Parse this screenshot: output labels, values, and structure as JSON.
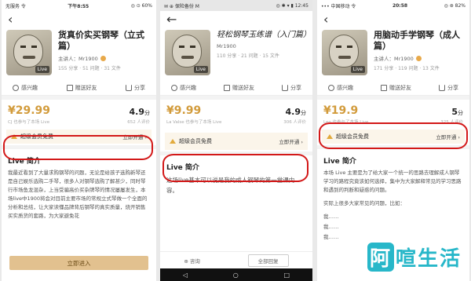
{
  "phones": [
    {
      "status": {
        "left": "无服务 令",
        "mid": "下午8:55",
        "right": "◎ ⊙ 60%"
      },
      "title": "货真价实买钢琴（立式篇）",
      "speaker": "主讲人：Mr1900",
      "stats": "155 分享 · 51 问题 · 31 文件",
      "cover_badge": "Live",
      "actions": [
        "感兴趣",
        "赠送好友",
        "分享"
      ],
      "price": "¥29.99",
      "rating": "4.9",
      "rating_unit": "分",
      "price_sub": "CJ 也参与了本场 Live",
      "rating_sub": "652 人评价",
      "vip_label": "超级会员免费",
      "vip_action": "立即开通 ›",
      "section_title": "Live 简介",
      "desc": [
        "我最近看到了大量求购钢琴的问题，无论是给孩子选购新琴还是自己娱乐选购二手琴，很多人对钢琴选购了解甚少，同时琴行市场鱼龙混杂，上当受骗高价买杂牌琴的情况屡屡发生，本场live中1900将会对目前主要市场的常规立式琴做一个全面的分析和总结，让大家读懂品牌背后钢琴的真实质量，烧开销售买实质货的套路，为大家避免花"
      ],
      "cta": "立即进入"
    },
    {
      "status": {
        "left": "✉ ⊕ 保险备份 M",
        "mid": "",
        "right": "◎ ✱ ▾ ▮ 12:45"
      },
      "title": "轻松钢琴玉练谱（入门篇）",
      "speaker": "Mr1900",
      "stats": "110 分享 · 21 问题 · 15 文件",
      "cover_badge": "Live",
      "actions": [
        "感兴趣",
        "赠送好友",
        "分享"
      ],
      "price": "¥9.99",
      "rating": "4.9",
      "rating_unit": "分",
      "price_sub": "La Valse 也参与了本场 Live",
      "rating_sub": "306 人评价",
      "vip_label": "超级会员免费",
      "vip_action": "立即开通 ›",
      "section_title": "Live 简介",
      "desc": [
        "这场live基本可以说是我的成人钢琴的第一堂课内容。"
      ],
      "bottom_left": "⊕ 咨询",
      "bottom_right": "全部回复",
      "navbar": [
        "◁",
        "○",
        "□"
      ]
    },
    {
      "status": {
        "left": "••• 中国移动 令",
        "mid": "20:58",
        "right": "◎ ⊛ 82%"
      },
      "title": "用脑动手学钢琴（成人篇）",
      "speaker": "主讲人：Mr1900",
      "stats": "171 分享 · 119 问题 · 13 文件",
      "cover_badge": "Live",
      "actions": [
        "感兴趣",
        "赠送好友",
        "分享"
      ],
      "price": "¥19.9",
      "rating": "5",
      "rating_unit": "分",
      "price_sub": "Leo 也参与了本场 Live",
      "rating_sub": "325 人评价",
      "vip_label": "超级会员免费",
      "vip_action": "立即开通 ›",
      "section_title": "Live 简介",
      "desc": [
        "本场 Live 主要是为了给大家一个统一的思路去理解成人钢琴学习的路程究竟该如何选择，集中为大家解释常见的学习思路和遇到的判断和疑惑的问题。",
        "实际上很多大家常见的问题，比如：",
        "我……",
        "我……",
        "我……"
      ],
      "cta": ""
    }
  ],
  "watermark": {
    "left": "阿",
    "right": "喧生活"
  },
  "colors": {
    "price": "#d29b3b",
    "circle": "#d31818",
    "cta": "#e2c18f",
    "watermark": "#27b7c9"
  }
}
